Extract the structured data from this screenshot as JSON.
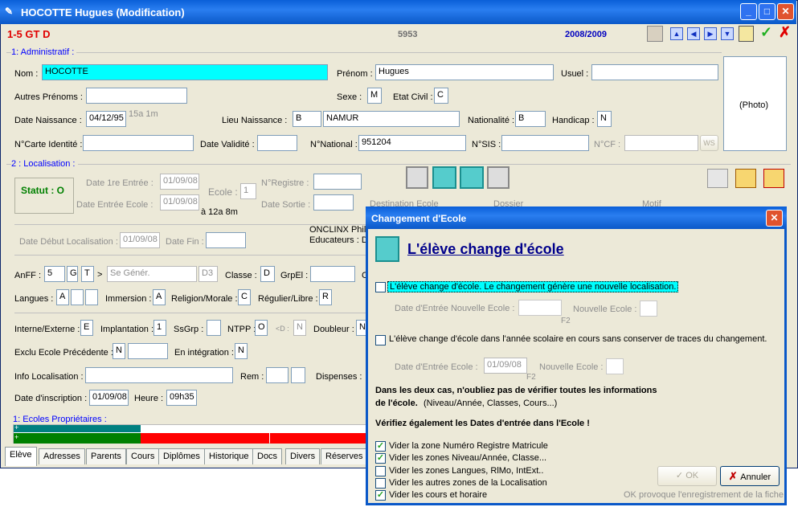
{
  "window": {
    "title": "HOCOTTE Hugues (Modification)"
  },
  "header": {
    "class_code": "1-5 GT D",
    "number": "5953",
    "year": "2008/2009",
    "ok_symbol": "✓",
    "cancel_symbol": "✗"
  },
  "admin": {
    "section_label": "1: Administratif :",
    "nom_label": "Nom :",
    "nom": "HOCOTTE",
    "prenom_label": "Prénom :",
    "prenom": "Hugues",
    "usuel_label": "Usuel :",
    "usuel": "",
    "autres_label": "Autres Prénoms :",
    "autres": "",
    "sexe_label": "Sexe :",
    "sexe": "M",
    "etat_label": "Etat Civil :",
    "etat": "C",
    "photo": "(Photo)",
    "dn_label": "Date Naissance :",
    "dn": "04/12/95",
    "age": "15a 1m",
    "lieu_label": "Lieu Naissance :",
    "lieu_code": "B",
    "lieu": "NAMUR",
    "nat_label": "Nationalité :",
    "nat": "B",
    "handicap_label": "Handicap :",
    "handicap": "N",
    "carte_label": "N°Carte Identité :",
    "carte": "",
    "validite_label": "Date Validité :",
    "validite": "",
    "national_label": "N°National :",
    "national": "951204",
    "sis_label": "N°SIS :",
    "sis": "",
    "cf_label": "N°CF :",
    "cf": "",
    "ws": "WS"
  },
  "loc": {
    "section_label": "2 : Localisation :",
    "statut": "Statut : O",
    "d1_label": "Date 1re Entrée :",
    "d1": "01/09/08",
    "ecole_label": "Ecole :",
    "ecole": "1",
    "registre_label": "N°Registre :",
    "registre": "",
    "de_label": "Date Entrée Ecole :",
    "de": "01/09/08",
    "de_age": "à 12a 8m",
    "sortie_label": "Date Sortie :",
    "sortie": "",
    "dest_label": "Destination Ecole",
    "dossier_label": "Dossier",
    "motif_label": "Motif",
    "ddl_label": "Date Début Localisation :",
    "ddl": "01/09/08",
    "fin_label": "Date Fin :",
    "fin": "",
    "onclinx": "ONCLINX Philip",
    "educateurs": "Educateurs : D",
    "anff_label": "AnFF :",
    "anff1": "5",
    "anff2": "G",
    "anff3": "T",
    "gt": ">",
    "se_gener": "Se Génér.",
    "d3": "D3",
    "classe_label": "Classe :",
    "classe": "D",
    "grpel_label": "GrpEl :",
    "grpel": "",
    "c_label": "C",
    "langues_label": "Langues :",
    "langue1": "A",
    "immersion_label": "Immersion :",
    "immersion": "A",
    "religion_label": "Religion/Morale :",
    "religion": "C",
    "regulier_label": "Régulier/Libre :",
    "regulier": "R",
    "interne_label": "Interne/Externe :",
    "interne": "E",
    "implantation_label": "Implantation :",
    "implantation": "1",
    "ssgrp_label": "SsGrp :",
    "ntpp_label": "NTPP :",
    "ntpp": "O",
    "d_label": "<D :",
    "d_val": "N",
    "doubleur_label": "Doubleur :",
    "doubleur": "N",
    "exclu_label": "Exclu Ecole Précédente :",
    "exclu": "N",
    "integration_label": "En intégration :",
    "integration": "N",
    "info_label": "Info Localisation :",
    "info": "",
    "rem_label": "Rem :",
    "dispenses_label": "Dispenses :",
    "inscription_label": "Date d'inscription :",
    "inscription": "01/09/08",
    "heure_label": "Heure :",
    "heure": "09h35",
    "proprietaires_label": "1: Ecoles Propriétaires :",
    "plus": "+"
  },
  "tabs": [
    "Elève",
    "Adresses",
    "Parents",
    "Cours",
    "Diplômes",
    "Historique",
    "Docs",
    "Divers",
    "Réserves"
  ],
  "dialog": {
    "title": "Changement d'Ecole",
    "heading": "L'élève change d'école",
    "opt1": "L'élève change d'école. Le changement génère une nouvelle localisation.",
    "date_label": "Date d'Entrée Nouvelle Ecole :",
    "nouvelle_label": "Nouvelle Ecole :",
    "f2": "F2",
    "opt2": "L'élève change d'école dans l'année scolaire en cours sans conserver de traces du changement.",
    "date2_label": "Date d'Entrée Ecole :",
    "date2": "01/09/08",
    "nouvelle2_label": "Nouvelle Ecole :",
    "warn_line1": "Dans les deux cas, n'oubliez pas de vérifier toutes les informations",
    "warn_line2_bold": "de l'école.",
    "warn_line2": "(Niveau/Année, Classes, Cours...)",
    "verify": "Vérifiez également les Dates d'entrée dans l'Ecole !",
    "checks": [
      {
        "label": "Vider la zone Numéro Registre Matricule",
        "checked": true
      },
      {
        "label": "Vider les zones Niveau/Année, Classe...",
        "checked": true
      },
      {
        "label": "Vider les zones Langues, RlMo, IntExt..",
        "checked": false
      },
      {
        "label": "Vider les autres zones de la Localisation",
        "checked": false
      },
      {
        "label": "Vider les cours et horaire",
        "checked": true
      }
    ],
    "ok": "OK",
    "annuler": "Annuler",
    "note": "OK provoque l'enregistrement de la fiche"
  }
}
